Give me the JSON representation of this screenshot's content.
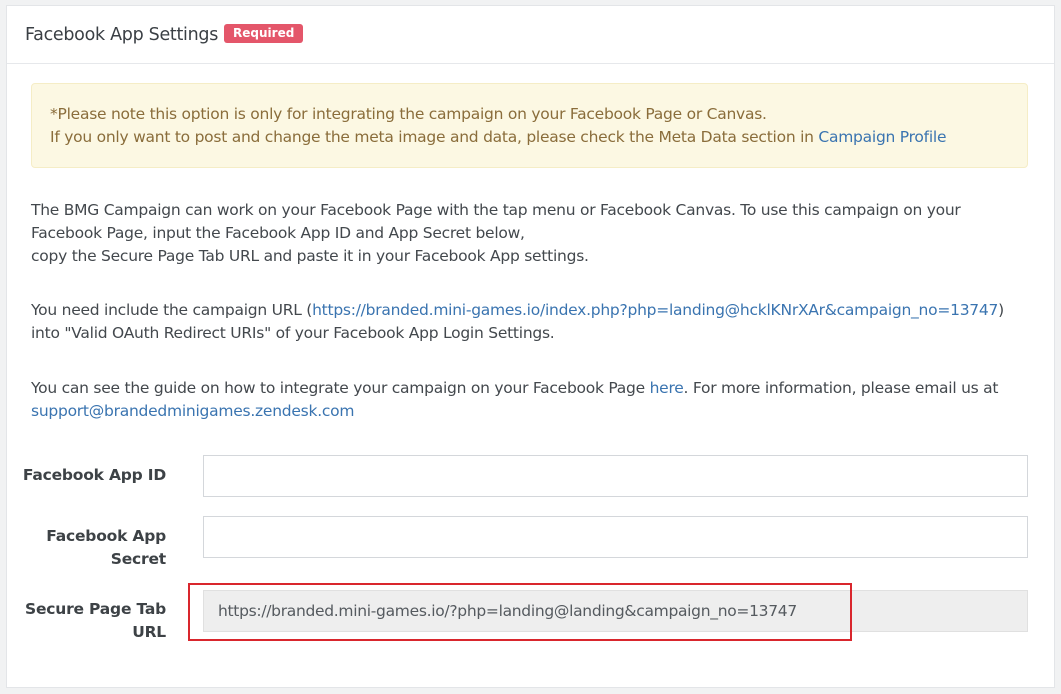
{
  "header": {
    "title": "Facebook App Settings",
    "badge": "Required"
  },
  "notice": {
    "line1": "*Please note this option is only for integrating the campaign on your Facebook Page or Canvas.",
    "line2_prefix": "If you only want to post and change the meta image and data, please check the Meta Data section in ",
    "line2_link": "Campaign Profile"
  },
  "intro": {
    "line1": "The BMG Campaign can work on your Facebook Page with the tap menu or Facebook Canvas. To use this campaign on your",
    "line2": "Facebook Page, input the Facebook App ID and App Secret below,",
    "line3": "copy the Secure Page Tab URL and paste it in your Facebook App settings."
  },
  "oauth": {
    "prefix": "You need include the campaign URL (",
    "url": "https://branded.mini-games.io/index.php?php=landing@hcklKNrXAr&campaign_no=13747",
    "suffix": ")",
    "line2": "into \"Valid OAuth Redirect URIs\" of your Facebook App Login Settings."
  },
  "guide": {
    "prefix": "You can see the guide on how to integrate your campaign on your Facebook Page ",
    "here_link": "here",
    "suffix": ". For more information, please email us at",
    "email": "support@brandedminigames.zendesk.com"
  },
  "form": {
    "app_id_label": "Facebook App ID",
    "app_id_value": "",
    "app_secret_label_1": "Facebook App",
    "app_secret_label_2": "Secret",
    "app_secret_value": "",
    "secure_tab_label_1": "Secure Page Tab",
    "secure_tab_label_2": "URL",
    "secure_tab_value": "https://branded.mini-games.io/?php=landing@landing&campaign_no=13747"
  },
  "colors": {
    "badge": "#e4566a",
    "link": "#3a74b0",
    "notice_bg": "#fcf8e3",
    "notice_text": "#8a6d3b",
    "highlight": "#d9262d"
  }
}
